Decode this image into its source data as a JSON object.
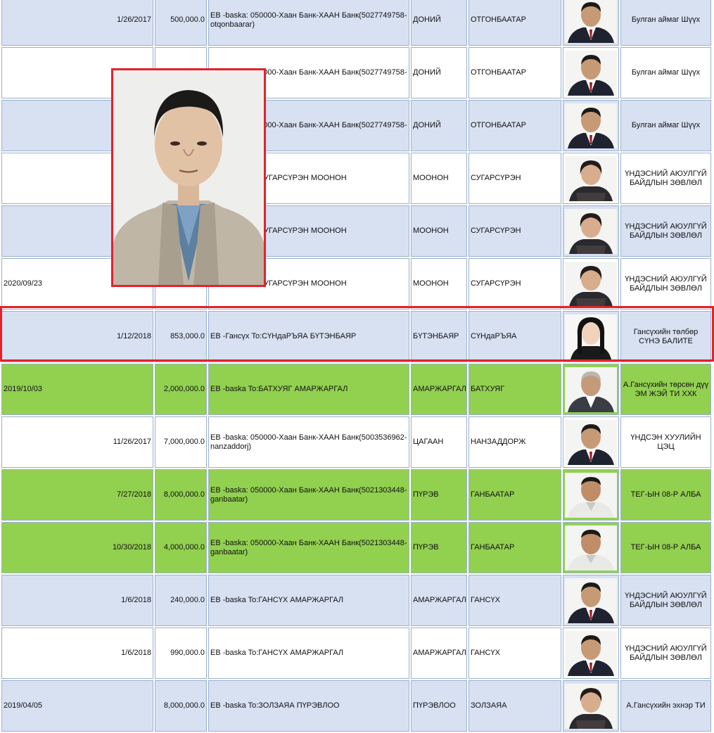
{
  "rows": [
    {
      "cls": "blue",
      "date": "1/26/2017",
      "date_left": false,
      "amount": "500,000.0",
      "desc": "EB -baska: 050000-Хаан Банк-ХААН Банк(5027749758-otqonbaarar)",
      "surname": "ДОНИЙ",
      "name": "ОТГОНБААТАР",
      "org": "Булган аймаг Шүүх",
      "photo": "man-suit"
    },
    {
      "cls": "white",
      "date": "",
      "date_left": false,
      "amount": "",
      "desc": "EB -baska: 050000-Хаан Банк-ХААН Банк(5027749758-",
      "surname": "ДОНИЙ",
      "name": "ОТГОНБААТАР",
      "org": "Булган аймаг Шүүх",
      "photo": "man-suit"
    },
    {
      "cls": "blue",
      "date": "",
      "date_left": false,
      "amount": "",
      "desc": "EB -baska: 050000-Хаан Банк-ХААН Банк(5027749758-",
      "surname": "ДОНИЙ",
      "name": "ОТГОНБААТАР",
      "org": "Булган аймаг Шүүх",
      "photo": "man-suit"
    },
    {
      "cls": "white",
      "date": "",
      "date_left": false,
      "amount": "",
      "desc": "EB -baska To:СУГАРСҮРЭН МООНОН",
      "surname": "МООНОН",
      "name": "СУГАРСҮРЭН",
      "org": "ҮНДЭСНИЙ АЮУЛГҮЙ БАЙДЛЫН ЗӨВЛӨЛ",
      "photo": "woman"
    },
    {
      "cls": "blue",
      "date": "",
      "date_left": false,
      "amount": "",
      "desc": "EB -baska To:СУГАРСҮРЭН МООНОН",
      "surname": "МООНОН",
      "name": "СУГАРСҮРЭН",
      "org": "ҮНДЭСНИЙ АЮУЛГҮЙ БАЙДЛЫН ЗӨВЛӨЛ",
      "photo": "woman"
    },
    {
      "cls": "white",
      "date": "2020/09/23",
      "date_left": true,
      "amount": "",
      "desc": "EB -baska To:СУГАРСҮРЭН МООНОН",
      "surname": "МООНОН",
      "name": "СУГАРСҮРЭН",
      "org": "ҮНДЭСНИЙ АЮУЛГҮЙ БАЙДЛЫН ЗӨВЛӨЛ",
      "photo": "woman"
    },
    {
      "cls": "blue",
      "date": "1/12/2018",
      "date_left": false,
      "amount": "853,000.0",
      "desc": "EB -Гансүх To:СҮНдаРЪЯА БҮТЭНБАЯР",
      "surname": "БҮТЭНБАЯР",
      "name": "СҮНдаРЪЯА",
      "org": "Гансүхийн төлбөр СҮНЭ БАЛИТЕ",
      "photo": "young-woman"
    },
    {
      "cls": "green",
      "date": "2019/10/03",
      "date_left": true,
      "amount": "2,000,000.0",
      "desc": "EB -baska To:БАТХУЯГ АМАРЖАРГАЛ",
      "surname": "АМАРЖАРГАЛ",
      "name": "БАТХУЯГ",
      "org": "А.Гансүхийн төрсөн дүү ЭМ ЖЭЙ ТИ ХХК",
      "photo": "older-man"
    },
    {
      "cls": "white",
      "date": "11/26/2017",
      "date_left": false,
      "amount": "7,000,000.0",
      "desc": "EB -baska: 050000-Хаан Банк-ХААН Банк(5003536962-nanzaddorj)",
      "surname": "ЦАГААН",
      "name": "НАНЗАДДОРЖ",
      "org": "ҮНДСЭН ХУУЛИЙН ЦЭЦ",
      "photo": "man-suit"
    },
    {
      "cls": "green",
      "date": "7/27/2018",
      "date_left": false,
      "amount": "8,000,000.0",
      "desc": "EB -baska: 050000-Хаан Банк-ХААН Банк(5021303448-ganbaatar)",
      "surname": "ПҮРЭВ",
      "name": "ГАНБААТАР",
      "org": "ТЕГ-ЫН 08-Р АЛБА",
      "photo": "man-shirt"
    },
    {
      "cls": "green",
      "date": "10/30/2018",
      "date_left": false,
      "amount": "4,000,000.0",
      "desc": "EB -baska: 050000-Хаан Банк-ХААН Банк(5021303448-ganbaatar)",
      "surname": "ПҮРЭВ",
      "name": "ГАНБААТАР",
      "org": "ТЕГ-ЫН 08-Р АЛБА",
      "photo": "man-shirt"
    },
    {
      "cls": "blue",
      "date": "1/6/2018",
      "date_left": false,
      "amount": "240,000.0",
      "desc": "EB -baska To:ГАНСҮХ АМАРЖАРГАЛ",
      "surname": "АМАРЖАРГАЛ",
      "name": "ГАНСҮХ",
      "org": "ҮНДЭСНИЙ АЮУЛГҮЙ БАЙДЛЫН ЗӨВЛӨЛ",
      "photo": "man-suit"
    },
    {
      "cls": "white",
      "date": "1/6/2018",
      "date_left": false,
      "amount": "990,000.0",
      "desc": "EB -baska To:ГАНСҮХ АМАРЖАРГАЛ",
      "surname": "АМАРЖАРГАЛ",
      "name": "ГАНСҮХ",
      "org": "ҮНДЭСНИЙ АЮУЛГҮЙ БАЙДЛЫН ЗӨВЛӨЛ",
      "photo": "man-suit"
    },
    {
      "cls": "blue",
      "date": "2019/04/05",
      "date_left": true,
      "amount": "8,000,000.0",
      "desc": "EB -baska To:ЗОЛЗАЯА ПҮРЭВЛОО",
      "surname": "ПҮРЭВЛОО",
      "name": "ЗОЛЗАЯА",
      "org": "А.Гансүхийн эхнэр ТИ",
      "photo": "woman"
    }
  ],
  "colors": {
    "row_blue": "#d8e1f2",
    "row_green": "#92d050",
    "highlight_red": "#e3222b",
    "cell_border": "#9ab0cc"
  }
}
